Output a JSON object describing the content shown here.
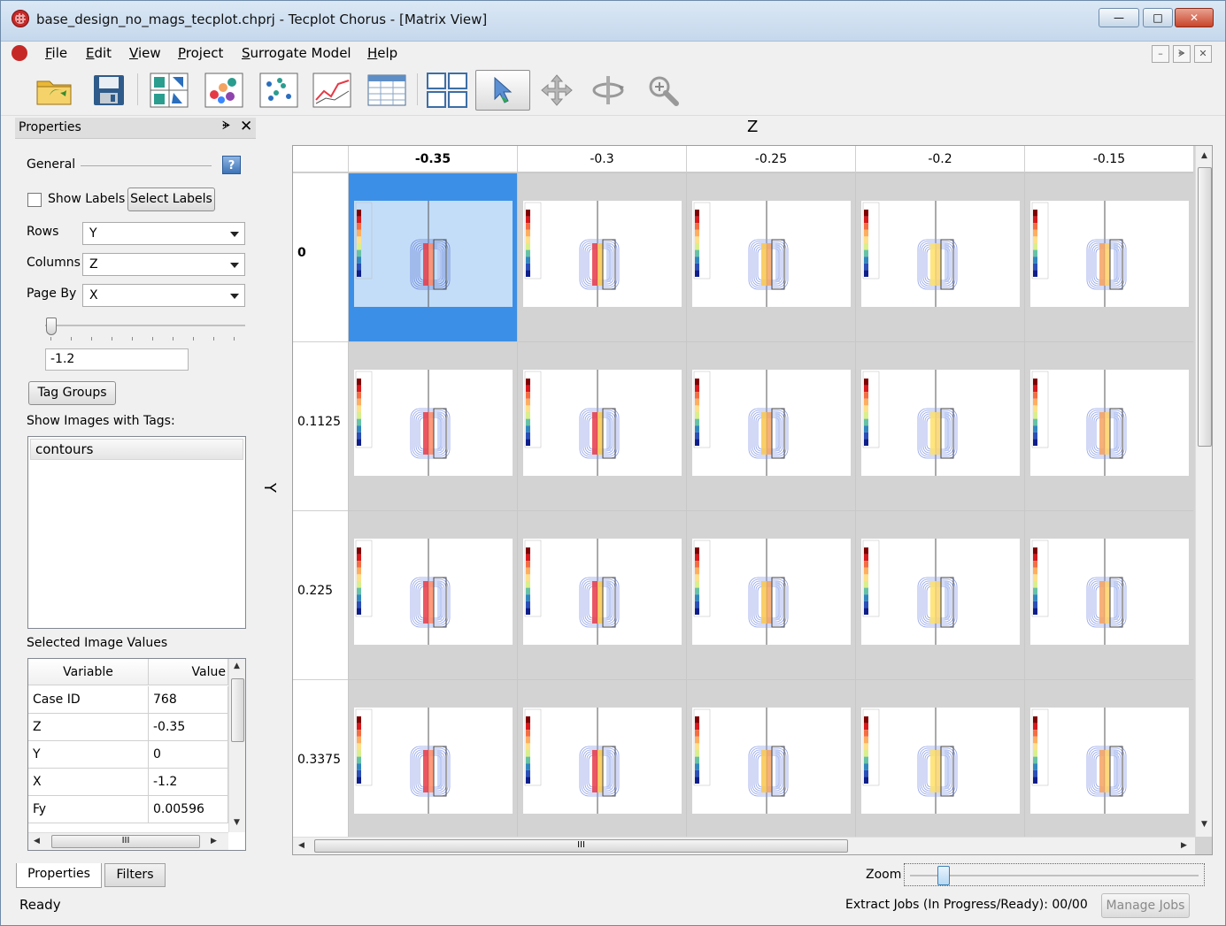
{
  "window": {
    "title": "base_design_no_mags_tecplot.chprj - Tecplot Chorus - [Matrix View]",
    "minimize": "—",
    "maximize": "□",
    "close": "✕"
  },
  "menu": {
    "items": [
      {
        "label": "File",
        "u": "F",
        "rest": "ile"
      },
      {
        "label": "Edit",
        "u": "E",
        "rest": "dit"
      },
      {
        "label": "View",
        "u": "V",
        "rest": "iew"
      },
      {
        "label": "Project",
        "u": "P",
        "rest": "roject"
      },
      {
        "label": "Surrogate Model",
        "u": "S",
        "rest": "urrogate Model"
      },
      {
        "label": "Help",
        "u": "H",
        "rest": "elp"
      }
    ],
    "mdi_min": "–",
    "mdi_restore": "ᗙ",
    "mdi_close": "✕"
  },
  "toolbar": {
    "icons": [
      "open-project-icon",
      "save-icon",
      "parallel-plot-icon",
      "scatter-3d-icon",
      "scatter-2d-icon",
      "line-plot-icon",
      "table-view-icon",
      "matrix-view-icon",
      "select-pointer-icon",
      "pan-icon",
      "rotate-icon",
      "zoom-icon"
    ]
  },
  "properties": {
    "title": "Properties",
    "float_btn": "ᗙ",
    "close_btn": "✕",
    "general": "General",
    "help": "?",
    "show_labels": "Show Labels",
    "select_labels": "Select Labels",
    "rows_label": "Rows",
    "rows_value": "Y",
    "columns_label": "Columns",
    "columns_value": "Z",
    "page_by_label": "Page By",
    "page_by_value": "X",
    "page_value": "-1.2",
    "page_slider_position": 0,
    "tag_groups": "Tag Groups",
    "show_images_label": "Show Images with Tags:",
    "tags": [
      "contours"
    ],
    "selected_values_label": "Selected Image Values",
    "table_headers": [
      "Variable",
      "Value"
    ],
    "table_rows": [
      [
        "Case ID",
        "768"
      ],
      [
        "Z",
        "-0.35"
      ],
      [
        "Y",
        "0"
      ],
      [
        "X",
        "-1.2"
      ],
      [
        "Fy",
        "0.00596"
      ]
    ],
    "hscroll_grip": "III"
  },
  "tabs": {
    "properties": "Properties",
    "filters": "Filters"
  },
  "matrix": {
    "column_axis": "Z",
    "row_axis": "Y",
    "columns": [
      "-0.35",
      "-0.3",
      "-0.25",
      "-0.2",
      "-0.15"
    ],
    "rows": [
      "0",
      "0.1125",
      "0.225",
      "0.3375"
    ],
    "selected": {
      "row": 0,
      "col": 0
    },
    "hscroll_grip": "III"
  },
  "status": {
    "text": "Ready",
    "zoom_label": "Zoom",
    "zoom_level": 0.1,
    "extract_jobs": "Extract Jobs (In Progress/Ready):  00/00",
    "manage_jobs": "Manage Jobs"
  },
  "colors": {
    "selection": "#3c8fe6",
    "cell_background": "#d3d3d3",
    "app_icon": "#c62828"
  }
}
